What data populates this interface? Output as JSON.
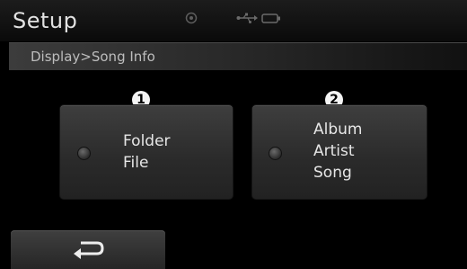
{
  "header": {
    "title": "Setup",
    "status_icons": [
      "navigation-status-icon",
      "usb-icon",
      "battery-icon"
    ]
  },
  "breadcrumb": "Display>Song Info",
  "options": [
    {
      "marker": "1",
      "lines": [
        "Folder",
        "File"
      ]
    },
    {
      "marker": "2",
      "lines": [
        "Album",
        "Artist",
        "Song"
      ]
    }
  ],
  "back_button": {
    "icon": "back-arrow-icon"
  }
}
